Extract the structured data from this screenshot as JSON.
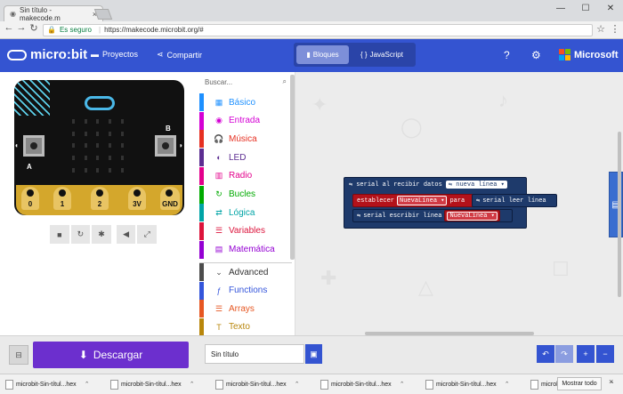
{
  "browser": {
    "tab_title": "Sin título - makecode.m",
    "tab_close": "×",
    "window_controls": [
      "—",
      "☐",
      "✕"
    ],
    "secure_label": "Es seguro",
    "url": "https://makecode.microbit.org/#"
  },
  "header": {
    "logo_text": "micro:bit",
    "projects_label": "Proyectos",
    "share_label": "Compartir",
    "blocks_tab": "Bloques",
    "js_tab": "JavaScript",
    "brand": "Microsoft",
    "colors": {
      "bar": "#3454d1",
      "ms_red": "#f25022",
      "ms_green": "#7fba00",
      "ms_blue": "#00a4ef",
      "ms_yellow": "#ffb900"
    }
  },
  "simulator": {
    "button_a": "A",
    "button_b": "B",
    "pins": [
      "0",
      "1",
      "2",
      "3V",
      "GND"
    ],
    "controls": [
      "stop-icon",
      "restart-icon",
      "debug-icon",
      "mute-icon",
      "fullscreen-icon"
    ]
  },
  "toolbox": {
    "search_placeholder": "Buscar...",
    "categories": [
      {
        "label": "Básico",
        "color": "#1e90ff",
        "icon": "grid-icon",
        "glyph": "▦"
      },
      {
        "label": "Entrada",
        "color": "#d400d4",
        "icon": "target-icon",
        "glyph": "◉"
      },
      {
        "label": "Música",
        "color": "#e63022",
        "icon": "headphones-icon",
        "glyph": "🎧"
      },
      {
        "label": "LED",
        "color": "#5c2d91",
        "icon": "toggle-icon",
        "glyph": "◐"
      },
      {
        "label": "Radio",
        "color": "#e3008c",
        "icon": "signal-icon",
        "glyph": "▥"
      },
      {
        "label": "Bucles",
        "color": "#00aa00",
        "icon": "refresh-icon",
        "glyph": "↻"
      },
      {
        "label": "Lógica",
        "color": "#00a4a6",
        "icon": "shuffle-icon",
        "glyph": "⇄"
      },
      {
        "label": "Variables",
        "color": "#dc143c",
        "icon": "list-icon",
        "glyph": "☰"
      },
      {
        "label": "Matemática",
        "color": "#9400d3",
        "icon": "calculator-icon",
        "glyph": "▤"
      }
    ],
    "advanced": [
      {
        "label": "Advanced",
        "color": "#4c4c4c",
        "icon": "chevron-down-icon",
        "glyph": "⌄"
      },
      {
        "label": "Functions",
        "color": "#3455db",
        "icon": "function-icon",
        "glyph": "ƒ"
      },
      {
        "label": "Arrays",
        "color": "#e65722",
        "icon": "list-icon",
        "glyph": "☰"
      },
      {
        "label": "Texto",
        "color": "#b8860b",
        "icon": "text-icon",
        "glyph": "T"
      }
    ]
  },
  "blocks": {
    "on_receive": "serial al recibir datos",
    "new_line_dropdown": "nueva línea ▾",
    "set_label": "establecer",
    "var_name": "NuevaLínea ▾",
    "to_label": "para",
    "read_line": "serial leer línea",
    "write_line": "serial escribir línea",
    "var_ref": "NuevaLínea ▾"
  },
  "bottom": {
    "download_label": "Descargar",
    "project_name": "Sin título"
  },
  "downloads": {
    "items": [
      "microbit-Sin-títul...hex",
      "microbit-Sin-títul...hex",
      "microbit-Sin-títul...hex",
      "microbit-Sin-títul...hex",
      "microbit-Sin-títul...hex",
      "microbit-Sin-títul...hex"
    ],
    "show_all": "Mostrar todo",
    "close": "×"
  }
}
